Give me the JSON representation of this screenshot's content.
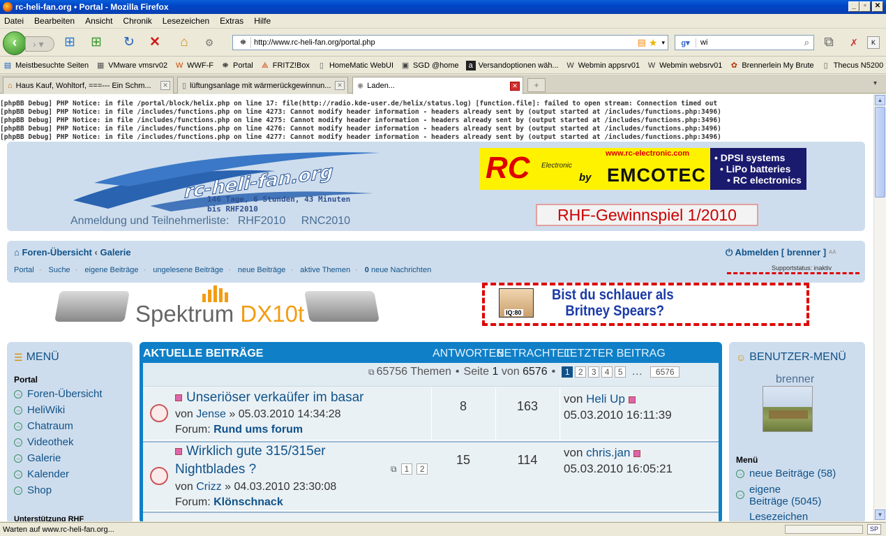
{
  "window": {
    "title": "rc-heli-fan.org • Portal - Mozilla Firefox"
  },
  "menu": [
    "Datei",
    "Bearbeiten",
    "Ansicht",
    "Chronik",
    "Lesezeichen",
    "Extras",
    "Hilfe"
  ],
  "nav": {
    "url": "http://www.rc-heli-fan.org/portal.php",
    "search_value": "wi"
  },
  "bookmarks": [
    "Meistbesuchte Seiten",
    "VMware vmsrv02",
    "WWF-F",
    "Portal",
    "FRITZ!Box",
    "HomeMatic WebUI",
    "SGD @home",
    "Versandoptionen wäh...",
    "Webmin appsrv01",
    "Webmin websrv01",
    "Brennerlein My Brute",
    "Thecus N5200"
  ],
  "tabs": [
    {
      "label": "Haus Kauf, Wohltorf, ===--- Ein Schm..."
    },
    {
      "label": "lüftungsanlage mit wärmerückgewinnun..."
    },
    {
      "label": "Laden..."
    }
  ],
  "debug": [
    {
      "prefix": "[phpBB Debug] PHP Notice",
      "text": ": in file /portal/block/helix.php on line 17: file(http://radio.kde-user.de/helix/status.log) [function.file]: failed to open stream: Connection timed out"
    },
    {
      "prefix": "[phpBB Debug] PHP Notice",
      "text": ": in file /includes/functions.php on line 4273: Cannot modify header information - headers already sent by (output started at /includes/functions.php:3496)"
    },
    {
      "prefix": "[phpBB Debug] PHP Notice",
      "text": ": in file /includes/functions.php on line 4275: Cannot modify header information - headers already sent by (output started at /includes/functions.php:3496)"
    },
    {
      "prefix": "[phpBB Debug] PHP Notice",
      "text": ": in file /includes/functions.php on line 4276: Cannot modify header information - headers already sent by (output started at /includes/functions.php:3496)"
    },
    {
      "prefix": "[phpBB Debug] PHP Notice",
      "text": ": in file /includes/functions.php on line 4277: Cannot modify header information - headers already sent by (output started at /includes/functions.php:3496)"
    }
  ],
  "header": {
    "logo_text": "rc-heli-fan.org",
    "countdown_line1": "146 Tage, 6 Stunden, 43 Minuten",
    "countdown_line2": "bis RHF2010",
    "reg_label": "Anmeldung und Teilnehmerliste:",
    "reg_link1": "RHF2010",
    "reg_link2": "RNC2010",
    "ad_url": "www.rc-electronic.com",
    "ad_rc": "RC",
    "ad_electronic": "Electronic",
    "ad_by": "by",
    "ad_brand": "EMCOTEC",
    "ad_items": [
      "• DPSI systems",
      "• LiPo batteries",
      "• RC electronics"
    ],
    "gewinnspiel": "RHF-Gewinnspiel 1/2010"
  },
  "navband": {
    "breadcrumb1": "Foren-Übersicht",
    "breadcrumb2": "Galerie",
    "logout": "Abmelden [ brenner ]",
    "links": [
      "Portal",
      "Suche",
      "eigene Beiträge",
      "ungelesene Beiträge",
      "neue Beiträge",
      "aktive Themen"
    ],
    "pm_count": "0",
    "pm_label": "neue Nachrichten",
    "support": "Supportstatus: inaktiv"
  },
  "ads": {
    "spektrum_a": "Spektrum",
    "spektrum_b": "DX10t",
    "britney_iq": "IQ:80",
    "britney_line1": "Bist du schlauer als",
    "britney_line2": "Britney Spears?"
  },
  "left": {
    "title": "MENÜ",
    "section": "Portal",
    "items": [
      "Foren-Übersicht",
      "HeliWiki",
      "Chatraum",
      "Videothek",
      "Galerie",
      "Kalender",
      "Shop"
    ],
    "cut": "Unterstützung RHF"
  },
  "center": {
    "title": "AKTUELLE BEITRÄGE",
    "col_answers": "ANTWORTEN",
    "col_views": "BETRACHTET",
    "col_last": "LETZTER BEITRAG",
    "threads": "65756 Themen",
    "page_label": "Seite",
    "page_cur": "1",
    "page_of": "von",
    "page_total": "6576",
    "pages": [
      "1",
      "2",
      "3",
      "4",
      "5"
    ],
    "ellipsis": "…",
    "last_page": "6576",
    "rows": [
      {
        "title": "Unseriöser verkaüfer im basar",
        "by": "von",
        "author": "Jense",
        "date": "» 05.03.2010 14:34:28",
        "forum_label": "Forum:",
        "forum": "Rund ums forum",
        "answers": "8",
        "views": "163",
        "last_by": "von",
        "last_user": "Heli Up",
        "last_date": "05.03.2010 16:11:39"
      },
      {
        "title": "Wirklich gute 315/315er",
        "title2": "Nightblades ?",
        "by": "von",
        "author": "Crizz",
        "date": "» 04.03.2010 23:30:08",
        "forum_label": "Forum:",
        "forum": "Klönschnack",
        "answers": "15",
        "views": "114",
        "last_by": "von",
        "last_user": "chris.jan",
        "last_date": "05.03.2010 16:05:21",
        "pages": [
          "1",
          "2"
        ]
      }
    ]
  },
  "right": {
    "title": "BENUTZER-MENÜ",
    "user": "brenner",
    "section": "Menü",
    "items": [
      "neue Beiträge (58)",
      "eigene",
      "Beiträge (5045)",
      "Lesezeichen"
    ]
  },
  "status": {
    "text": "Warten auf www.rc-heli-fan.org...",
    "sp": "SP"
  }
}
